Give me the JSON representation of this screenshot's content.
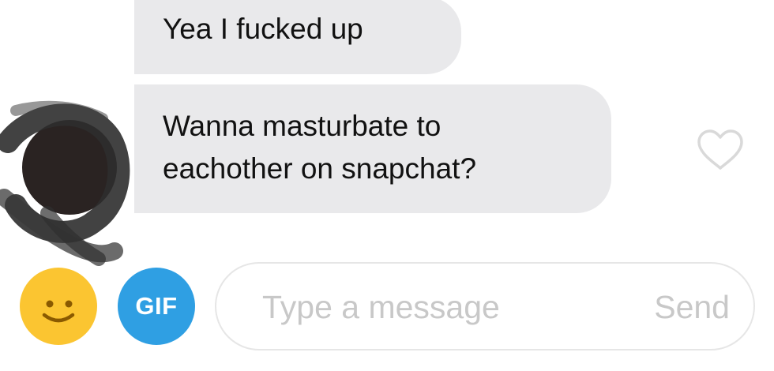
{
  "messages": [
    {
      "text": "Yea I fucked up"
    },
    {
      "text": "Wanna masturbate to\neachother on snapchat?"
    }
  ],
  "composer": {
    "gif_label": "GIF",
    "placeholder": "Type a message",
    "send_label": "Send"
  },
  "icons": {
    "emoji": "smiley-face-icon",
    "like": "heart-outline-icon",
    "avatar": "scribbled-out-avatar"
  },
  "colors": {
    "bubble": "#e9e9eb",
    "gif_button": "#2f9fe3",
    "emoji_button": "#fbc531",
    "placeholder_text": "#c8c8c8"
  }
}
